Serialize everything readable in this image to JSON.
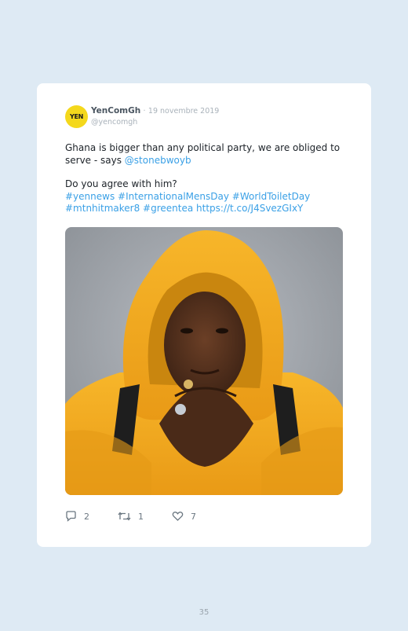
{
  "tweet": {
    "avatar_text": "YEN",
    "display_name": "YenComGh",
    "separator": "·",
    "date": "19 novembre 2019",
    "handle": "@yencomgh",
    "line1_text": "Ghana is bigger than any political party, we are obliged to serve - says ",
    "mention": "@stonebwoyb",
    "line2_text": "Do you agree with him?",
    "hashtags": "#yennews #InternationalMensDay #WorldToiletDay #mtnhitmaker8 #greentea",
    "short_link": "https://t.co/J4SvezGIxY",
    "reply_count": "2",
    "retweet_count": "1",
    "like_count": "7"
  },
  "page": {
    "number": "35"
  },
  "colors": {
    "background": "#deeaf4",
    "card": "#ffffff",
    "link": "#3aa0e6",
    "avatar": "#f4d81c",
    "hoodie": "#f2a81e"
  },
  "icons": [
    "reply-icon",
    "retweet-icon",
    "like-icon"
  ]
}
